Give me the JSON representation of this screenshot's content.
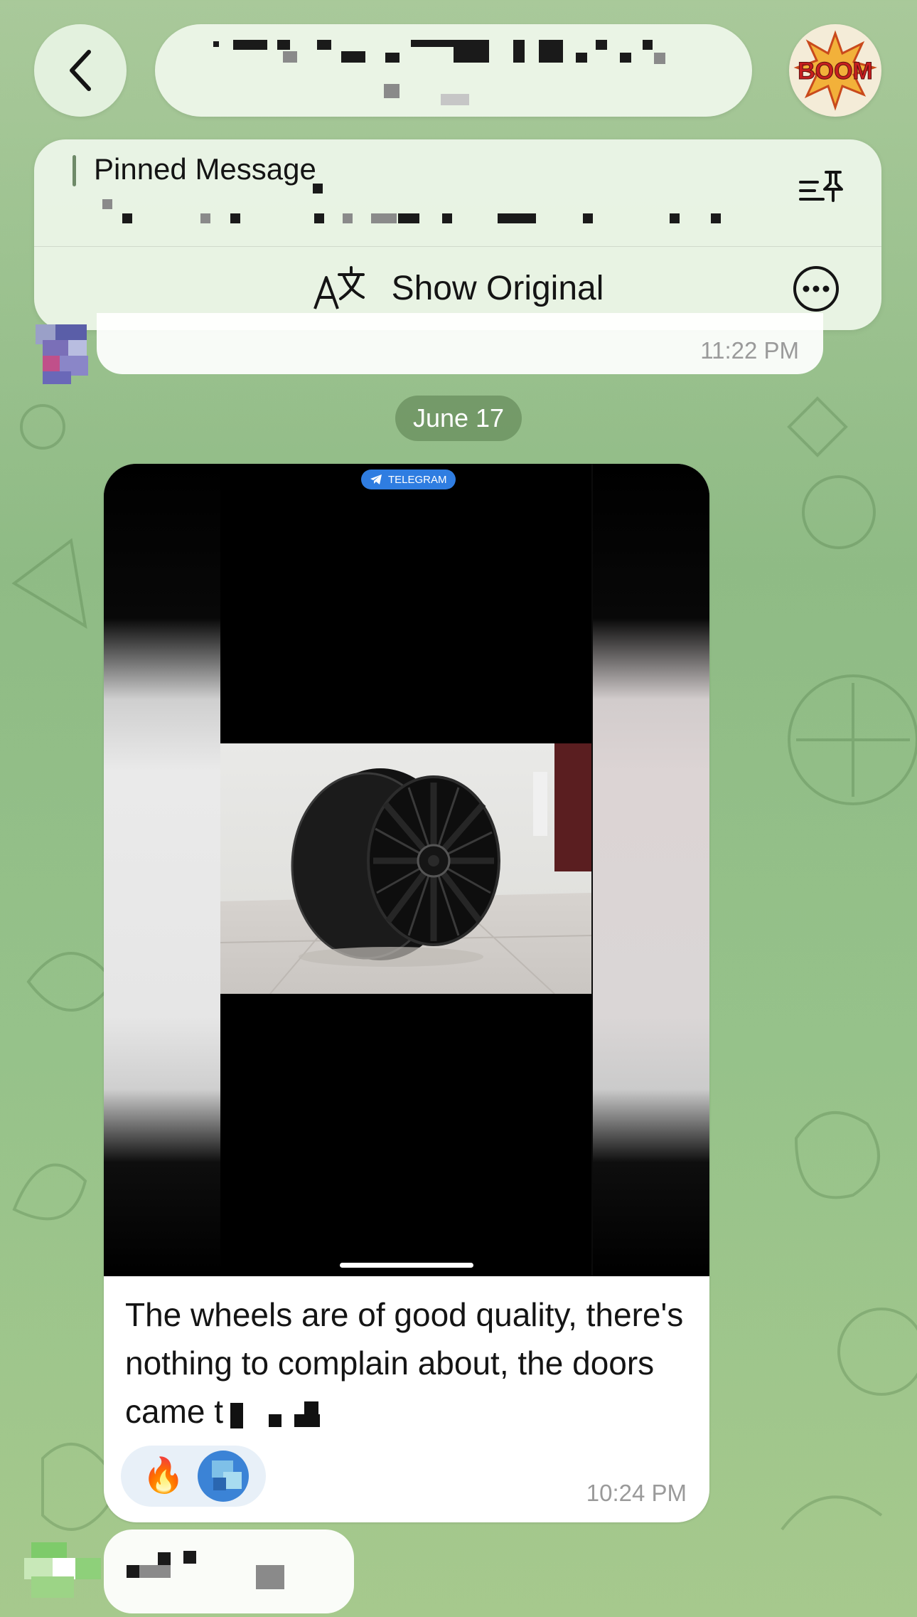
{
  "header": {
    "back_icon": "chevron-left-icon",
    "chat_title": "",
    "avatar_label": "BOOM"
  },
  "pinned": {
    "title": "Pinned Message",
    "preview": "",
    "pin_list_icon": "pin-list-icon",
    "show_original_label": "Show Original",
    "translate_icon": "translate-icon",
    "more_icon": "more-horizontal-icon"
  },
  "previous_message": {
    "time": "11:22 PM"
  },
  "date_separator": "June 17",
  "media_message": {
    "badge": "TELEGRAM",
    "caption": "The wheels are of good quality, there's nothing to complain about, the doors came t",
    "reactions": [
      {
        "emoji": "🔥"
      },
      {
        "type": "avatar"
      }
    ],
    "time": "10:24 PM"
  },
  "colors": {
    "accent": "#2f7de1",
    "date_pill": "#668c5c",
    "time_text": "#9a9a9a"
  }
}
